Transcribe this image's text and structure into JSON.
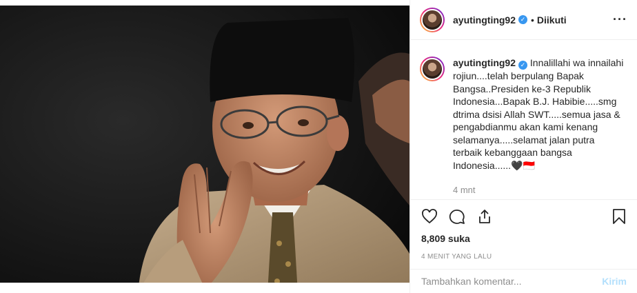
{
  "post": {
    "username": "ayutingting92",
    "follow_status": "Diikuti",
    "caption_user": "ayutingting92",
    "caption_text": "Innalillahi wa innailahi rojiun....telah berpulang Bapak Bangsa..Presiden ke-3 Republik Indonesia...Bapak B.J. Habibie.....smg dtrima dsisi Allah SWT.....semua jasa & pengabdianmu akan kami kenang selamanya.....selamat jalan putra terbaik kebanggaan bangsa Indonesia......🖤🇮🇩",
    "caption_time": "4 mnt",
    "likes": "8,809 suka",
    "posted_ago": "4 MENIT YANG LALU",
    "comment_placeholder": "Tambahkan komentar...",
    "send_label": "Kirim"
  },
  "icons": [
    "heart-icon",
    "comment-icon",
    "share-icon",
    "bookmark-icon",
    "verified-icon",
    "more-options-icon"
  ],
  "colors": {
    "link_blue": "#3897f0",
    "disabled_send": "#b2dffc",
    "muted_gray": "#8e8e8e"
  }
}
